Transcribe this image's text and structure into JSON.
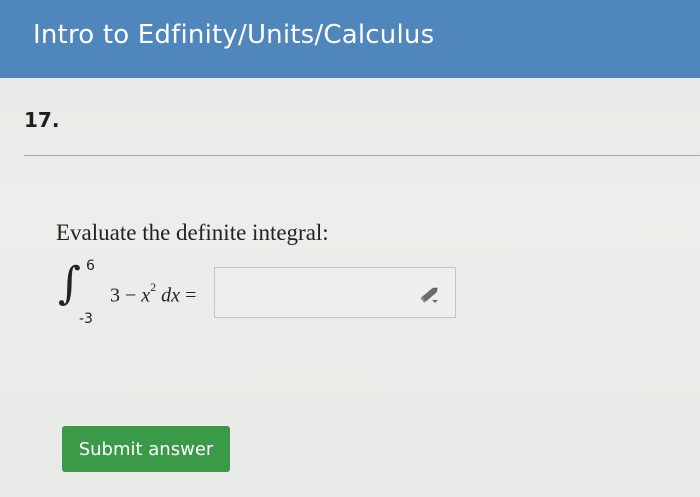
{
  "header": {
    "title": "Intro to Edfinity/Units/Calculus"
  },
  "question": {
    "number": "17.",
    "prompt": "Evaluate the definite integral:",
    "integral": {
      "upper_limit": "6",
      "lower_limit": "-3",
      "constant": "3",
      "minus": "−",
      "variable": "x",
      "exponent": "2",
      "differential": "dx",
      "equals": "="
    },
    "answer": {
      "value": "",
      "icon": "pencil-icon"
    }
  },
  "actions": {
    "submit_label": "Submit answer"
  },
  "colors": {
    "header_bg": "#4f86bb",
    "submit_bg": "#3b9a48"
  }
}
